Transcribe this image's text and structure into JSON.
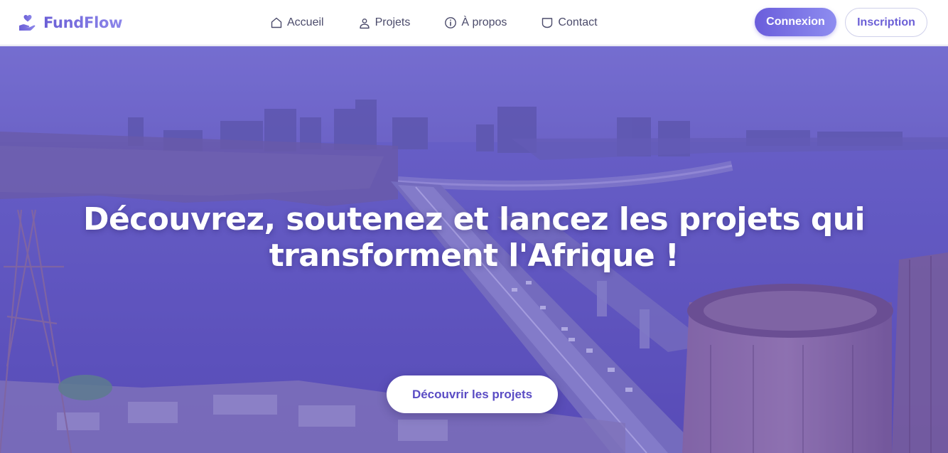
{
  "brand": {
    "name": "FundFlow",
    "icon": "hand-heart-icon"
  },
  "nav": {
    "items": [
      {
        "label": "Accueil",
        "icon": "home-icon"
      },
      {
        "label": "Projets",
        "icon": "user-icon"
      },
      {
        "label": "À propos",
        "icon": "info-icon"
      },
      {
        "label": "Contact",
        "icon": "chat-icon"
      }
    ]
  },
  "auth": {
    "login_label": "Connexion",
    "signup_label": "Inscription"
  },
  "hero": {
    "title_line1": "Découvrez, soutenez et lancez les projets qui",
    "title_line2": "transforment l'Afrique !",
    "cta_label": "Découvrir les projets"
  },
  "colors": {
    "accent": "#6b5fd6",
    "accent_light": "#8e8df0",
    "hero_overlay": "#5d52b4",
    "nav_text": "#4b4b6b"
  }
}
